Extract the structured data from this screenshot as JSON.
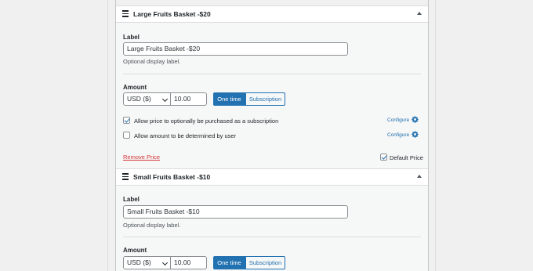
{
  "prices": [
    {
      "title": "Large Fruits Basket -$20",
      "label_heading": "Label",
      "label_value": "Large Fruits Basket -$20",
      "label_help": "Optional display label.",
      "amount_heading": "Amount",
      "currency": "USD ($)",
      "amount": "10.00",
      "one_time": "One time",
      "subscription": "Subscription",
      "opt1_label": "Allow price to optionally be purchased as a subscription",
      "opt1_checked": true,
      "opt2_label": "Allow amount to be determined by user",
      "opt2_checked": false,
      "configure": "Configure",
      "remove": "Remove Price",
      "default_label": "Default Price",
      "default_checked": true
    },
    {
      "title": "Small Fruits Basket -$10",
      "label_heading": "Label",
      "label_value": "Small Fruits Basket -$10",
      "label_help": "Optional display label.",
      "amount_heading": "Amount",
      "currency": "USD ($)",
      "amount": "10.00",
      "one_time": "One time",
      "subscription": "Subscription"
    }
  ],
  "colors": {
    "accent": "#2271b1",
    "danger": "#d63638",
    "panel_bg": "#f6f7f7"
  }
}
